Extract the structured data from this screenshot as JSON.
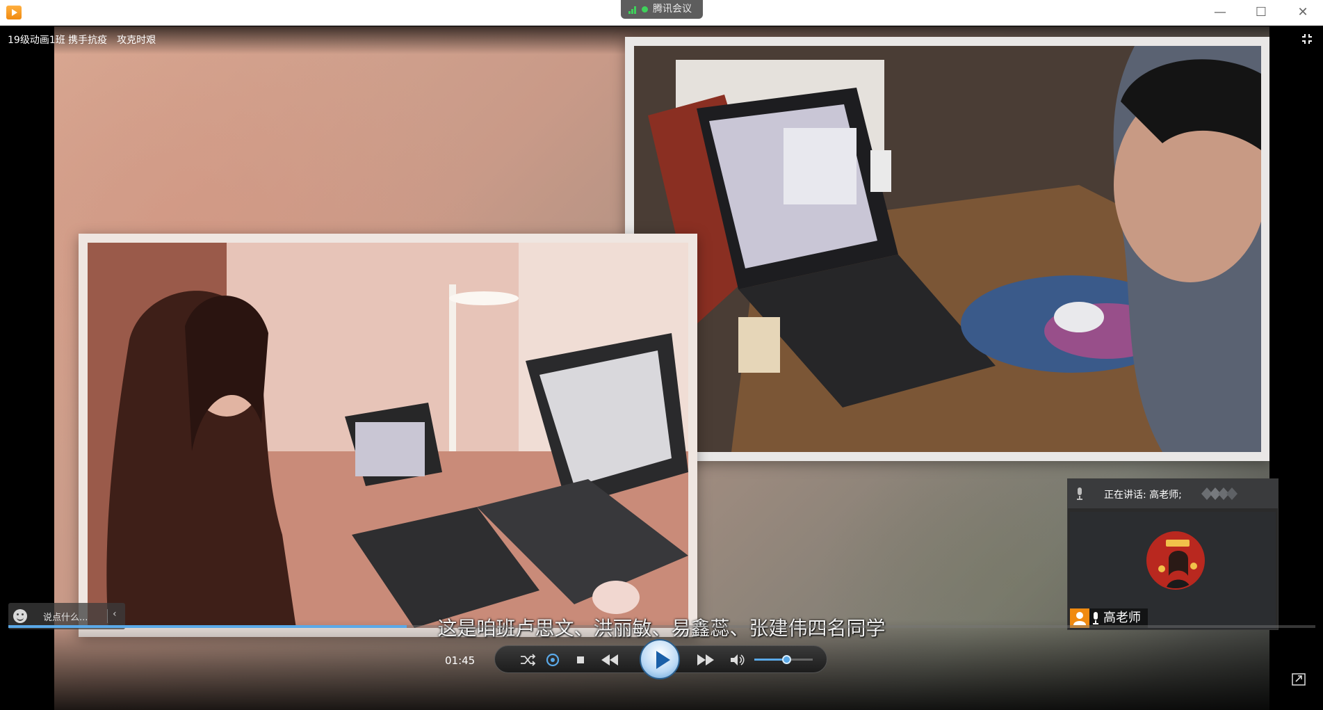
{
  "window": {
    "meeting_label": "腾讯会议",
    "minimize": "—",
    "maximize": "☐",
    "close": "✕"
  },
  "video": {
    "title": "19级动画1班 携手抗疫　攻克时艰",
    "subtitle": "这是咱班卢思文、洪丽敏、易鑫蕊、张建伟四名同学"
  },
  "chat": {
    "placeholder": "说点什么...",
    "collapse_glyph": "‹"
  },
  "speaker_panel": {
    "now_speaking": "正在讲话: 高老师;",
    "participant_name": "高老师"
  },
  "player": {
    "time": "01:45",
    "progress": 0.305,
    "volume": 0.55
  },
  "colors": {
    "accent": "#5aa9e8",
    "brand_orange": "#f08a10",
    "signal_green": "#3fd15b"
  }
}
